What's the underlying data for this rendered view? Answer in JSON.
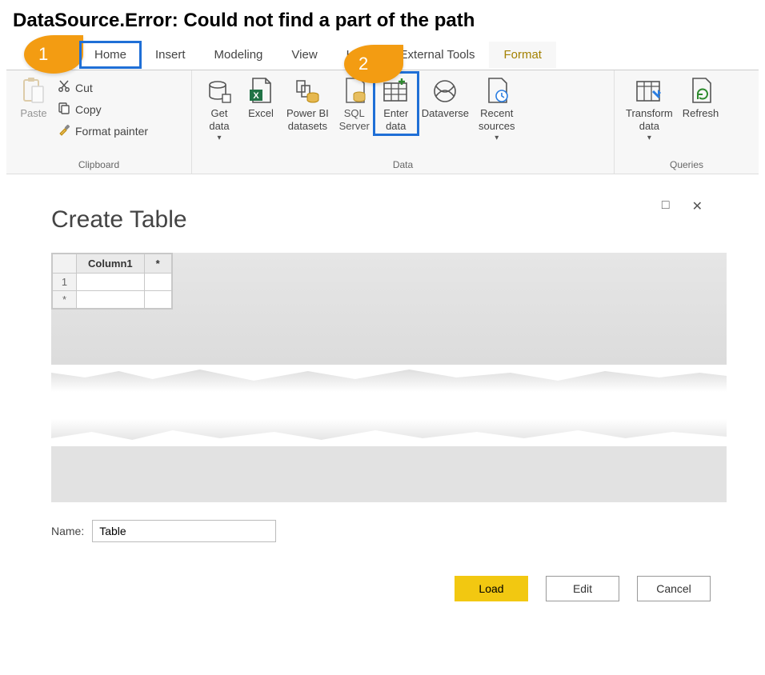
{
  "page_title": "DataSource.Error: Could not find a part of the path",
  "callouts": {
    "one": "1",
    "two": "2"
  },
  "tabs": {
    "home": "Home",
    "insert": "Insert",
    "modeling": "Modeling",
    "view": "View",
    "help": "Help",
    "external": "External Tools",
    "format": "Format"
  },
  "ribbon": {
    "clipboard": {
      "label": "Clipboard",
      "paste": "Paste",
      "cut": "Cut",
      "copy": "Copy",
      "format_painter": "Format painter"
    },
    "data": {
      "label": "Data",
      "get_data": "Get\ndata",
      "excel": "Excel",
      "powerbi": "Power BI\ndatasets",
      "sql": "SQL\nServer",
      "enter_data": "Enter\ndata",
      "dataverse": "Dataverse",
      "recent": "Recent\nsources"
    },
    "queries": {
      "label": "Queries",
      "transform": "Transform\ndata",
      "refresh": "Refresh"
    }
  },
  "dialog": {
    "title": "Create Table",
    "column1": "Column1",
    "star": "*",
    "row1": "1",
    "name_label": "Name:",
    "name_value": "Table",
    "load": "Load",
    "edit": "Edit",
    "cancel": "Cancel",
    "maximize": "□",
    "close": "✕"
  }
}
